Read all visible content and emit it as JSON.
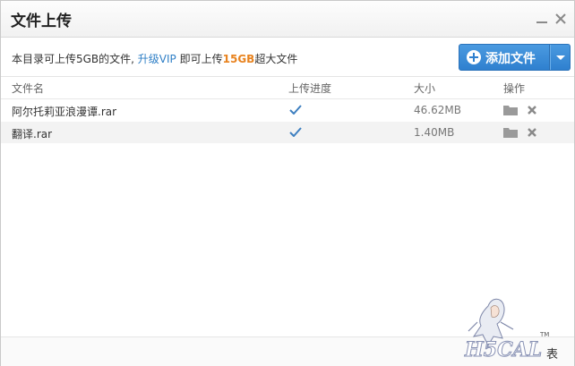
{
  "window": {
    "title": "文件上传"
  },
  "info": {
    "prefix": "本目录可上传5GB的文件, ",
    "upgrade_link": "升级VIP",
    "middle": " 即可上传",
    "quota": "15GB",
    "suffix": "超大文件"
  },
  "add_button": {
    "label": "添加文件",
    "color": "#2f80cf"
  },
  "table": {
    "headers": {
      "name": "文件名",
      "progress": "上传进度",
      "size": "大小",
      "action": "操作"
    },
    "rows": [
      {
        "name": "阿尔托莉亚浪漫谭.rar",
        "status": "check-icon",
        "size": "46.62MB"
      },
      {
        "name": "翻译.rar",
        "status": "check-icon",
        "size": "1.40MB"
      }
    ]
  },
  "watermark": {
    "logo_text": "H5CAL",
    "tm": "TM",
    "visible_text": "表"
  }
}
